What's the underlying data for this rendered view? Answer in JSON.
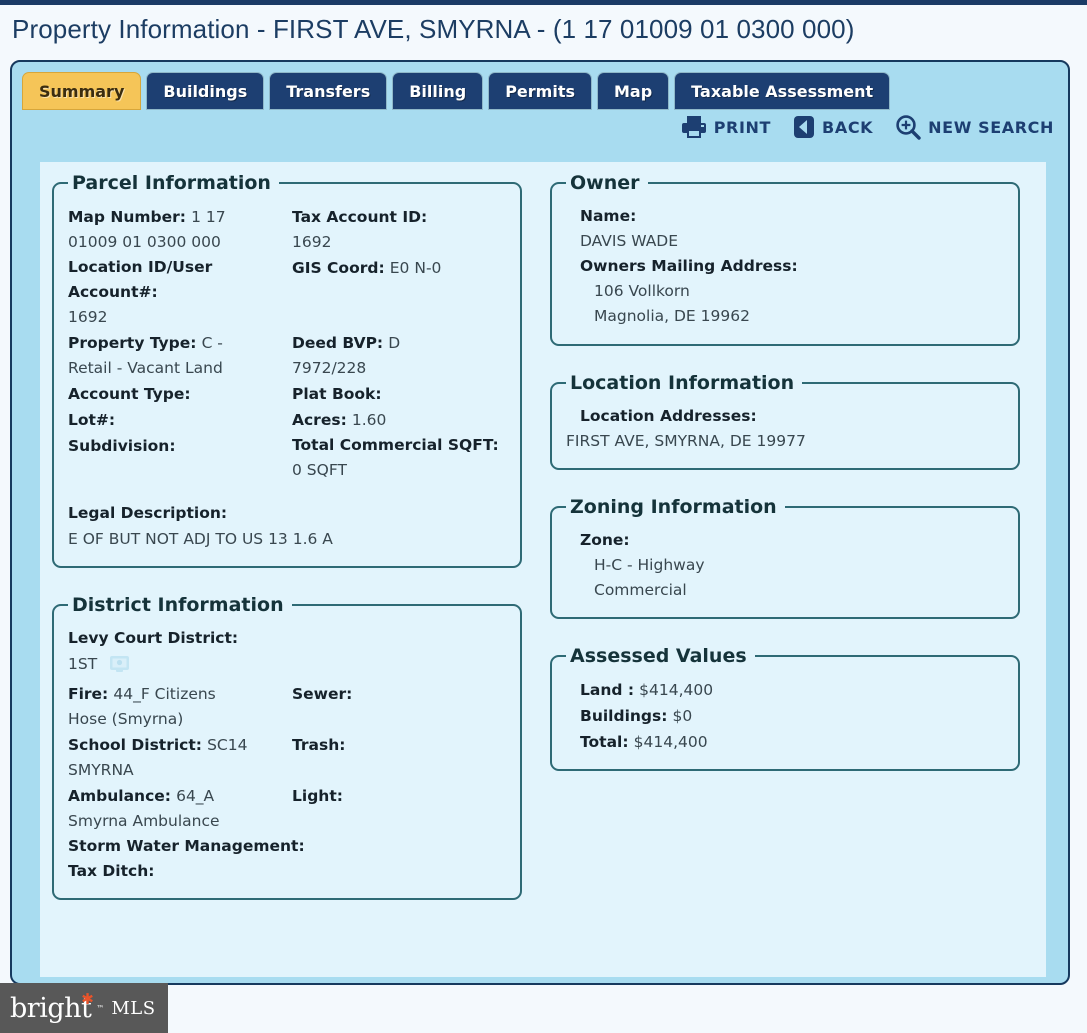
{
  "page": {
    "title": "Property Information - FIRST AVE, SMYRNA - (1 17 01009 01 0300 000)"
  },
  "tabs": [
    {
      "label": "Summary",
      "active": true
    },
    {
      "label": "Buildings",
      "active": false
    },
    {
      "label": "Transfers",
      "active": false
    },
    {
      "label": "Billing",
      "active": false
    },
    {
      "label": "Permits",
      "active": false
    },
    {
      "label": "Map",
      "active": false
    },
    {
      "label": "Taxable Assessment",
      "active": false
    }
  ],
  "actions": [
    {
      "label": "PRINT",
      "icon": "printer-icon"
    },
    {
      "label": "BACK",
      "icon": "back-arrow-icon"
    },
    {
      "label": "NEW SEARCH",
      "icon": "magnifier-plus-icon"
    }
  ],
  "parcel": {
    "legend": "Parcel Information",
    "map_number_label": "Map Number:",
    "map_number_value": "1 17",
    "map_number_value2": "01009 01 0300 000",
    "tax_account_id_label": "Tax Account ID:",
    "tax_account_id_value": "1692",
    "location_id_label": "Location ID/User Account#:",
    "location_id_value": "1692",
    "gis_coord_label": "GIS Coord:",
    "gis_coord_value": "E0 N-0",
    "property_type_label": "Property Type:",
    "property_type_value": "C -",
    "property_type_value2": "Retail - Vacant Land",
    "deed_bvp_label": "Deed BVP:",
    "deed_bvp_value": "D",
    "deed_bvp_value2": "7972/228",
    "account_type_label": "Account Type:",
    "account_type_value": "",
    "plat_book_label": "Plat Book:",
    "plat_book_value": "",
    "lot_label": "Lot#:",
    "lot_value": "",
    "acres_label": "Acres:",
    "acres_value": "1.60",
    "subdivision_label": "Subdivision:",
    "subdivision_value": "",
    "total_commercial_sqft_label": "Total Commercial SQFT:",
    "total_commercial_sqft_value": "0 SQFT",
    "legal_description_label": "Legal Description:",
    "legal_description_value": "E OF BUT NOT ADJ TO US 13 1.6 A"
  },
  "district": {
    "legend": "District Information",
    "levy_court_label": "Levy Court District:",
    "levy_court_value": "1ST",
    "levy_court_icon": "image-placeholder-icon",
    "fire_label": "Fire:",
    "fire_value": "44_F Citizens",
    "fire_value2": "Hose (Smyrna)",
    "sewer_label": "Sewer:",
    "sewer_value": "",
    "school_district_label": "School District:",
    "school_district_value": "SC14",
    "school_district_value2": "SMYRNA",
    "trash_label": "Trash:",
    "trash_value": "",
    "ambulance_label": "Ambulance:",
    "ambulance_value": "64_A",
    "ambulance_value2": "Smyrna Ambulance",
    "light_label": "Light:",
    "light_value": "",
    "storm_water_label": "Storm Water Management:",
    "storm_water_value": "",
    "tax_ditch_label": "Tax Ditch:",
    "tax_ditch_value": ""
  },
  "owner": {
    "legend": "Owner",
    "name_label": "Name:",
    "name_value": "DAVIS WADE",
    "mailing_label": "Owners Mailing Address:",
    "mailing_line1": "106 Vollkorn",
    "mailing_line2": "Magnolia, DE 19962"
  },
  "location": {
    "legend": "Location Information",
    "addresses_label": "Location Addresses:",
    "addresses_value": "FIRST AVE, SMYRNA, DE 19977"
  },
  "zoning": {
    "legend": "Zoning Information",
    "zone_label": "Zone:",
    "zone_line1": "H-C - Highway",
    "zone_line2": "Commercial"
  },
  "assessed": {
    "legend": "Assessed Values",
    "land_label": "Land :",
    "land_value": "$414,400",
    "buildings_label": "Buildings:",
    "buildings_value": "$0",
    "total_label": "Total:",
    "total_value": "$414,400"
  },
  "watermark": {
    "word": "bright",
    "tm": "™",
    "mls": "MLS"
  },
  "colors": {
    "tab_active": "#f5c558",
    "tab_inactive": "#1d3f72",
    "card_bg": "#a8dcf0",
    "content_bg": "#e2f4fc",
    "panel_border": "#2e6a75",
    "title": "#1c3d63",
    "watermark_bar": "#585858",
    "watermark_star": "#e8532a"
  }
}
